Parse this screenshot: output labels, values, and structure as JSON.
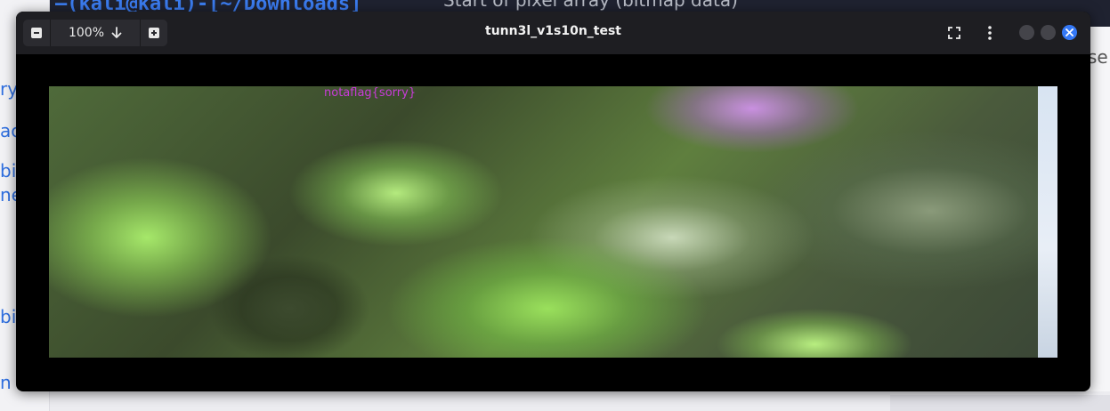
{
  "background": {
    "terminal_prompt": "—(kali@kali)-[~/Downloads]",
    "right_text": "Start of pixel array (bitmap data)",
    "right_fragment": "se",
    "sidebar_fragments": [
      "ry",
      "ac",
      "bi",
      "ne",
      "bit",
      "n"
    ]
  },
  "viewer": {
    "title": "tunn3l_v1s10n_test",
    "zoom_level": "100%",
    "icons": {
      "zoom_out": "minus-square-icon",
      "zoom_dropdown": "arrow-down-icon",
      "zoom_in": "plus-square-icon",
      "fullscreen": "fullscreen-icon",
      "menu": "kebab-menu-icon",
      "close": "close-icon"
    },
    "image_text": "notaflag{sorry}",
    "colors": {
      "accent": "#3478f6",
      "overlay_text": "#c83cd8"
    }
  }
}
